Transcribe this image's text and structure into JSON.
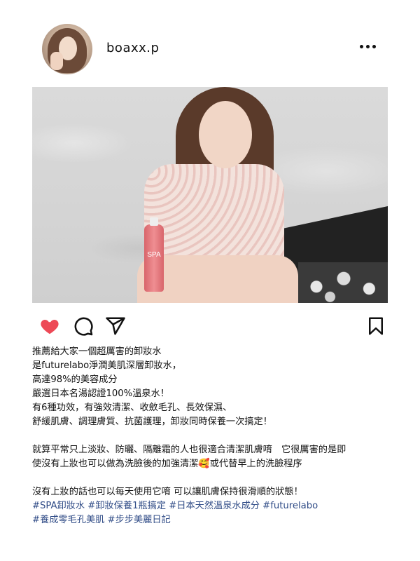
{
  "header": {
    "username": "boaxx.p",
    "more_icon": "more-horizontal-icon"
  },
  "photo": {
    "bottle_label": "SPA"
  },
  "actions": {
    "like_icon": "heart-filled-icon",
    "like_color": "#ed4956",
    "comment_icon": "comment-icon",
    "share_icon": "send-icon",
    "save_icon": "bookmark-icon"
  },
  "caption": {
    "lines": [
      "推薦給大家一個超厲害的卸妝水",
      "是futurelabo淨潤美肌深層卸妝水，",
      "高達98%的美容成分",
      "嚴選日本名湯認證100%溫泉水！",
      "有6種功效，有強效清潔、收斂毛孔、長效保濕、",
      "舒緩肌膚、調理膚質、抗菌護理，卸妝同時保養一次搞定！",
      "",
      "就算平常只上淡妝、防曬、隔離霜的人也很適合清潔肌膚唷　它很厲害的是即",
      "使沒有上妝也可以做為洗臉後的加強清潔🥰或代替早上的洗臉程序",
      "",
      "沒有上妝的話也可以每天使用它唷 可以讓肌膚保持很滑順的狀態！"
    ]
  },
  "hashtags": {
    "color": "#2f4b86",
    "lines": [
      "#SPA卸妝水 #卸妝保養1瓶搞定 #日本天然溫泉水成分 #futurelabo",
      "#養成零毛孔美肌 #步步美麗日記"
    ]
  }
}
